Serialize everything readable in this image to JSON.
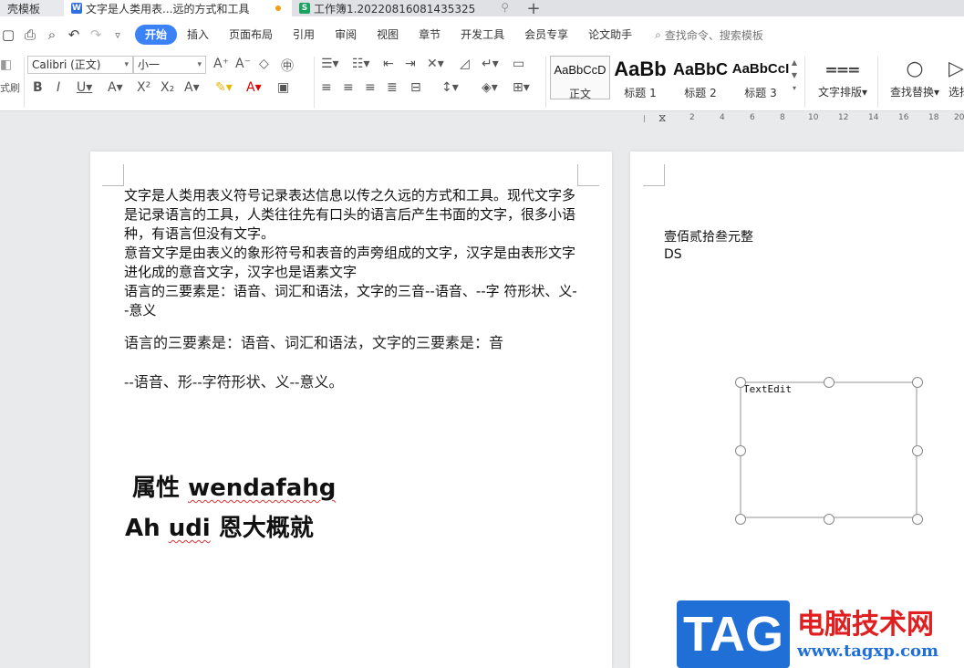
{
  "tabs": [
    {
      "label": "壳模板"
    },
    {
      "label": "文字是人类用表...远的方式和工具"
    },
    {
      "label": "工作簿1.20220816081435325"
    }
  ],
  "menu": {
    "items": [
      "开始",
      "插入",
      "页面布局",
      "引用",
      "审阅",
      "视图",
      "章节",
      "开发工具",
      "会员专享",
      "论文助手"
    ],
    "search": "查找命令、搜索模板"
  },
  "ribbon": {
    "cut_label": "式刷",
    "font_name": "Calibri (正文)",
    "font_size": "小一",
    "styles": [
      {
        "preview": "AaBbCcD",
        "name": "正文"
      },
      {
        "preview": "AaBb",
        "name": "标题 1"
      },
      {
        "preview": "AaBbC",
        "name": "标题 2"
      },
      {
        "preview": "AaBbCcI",
        "name": "标题 3"
      }
    ],
    "text_layout": "文字排版",
    "find_replace": "查找替换",
    "select": "选择"
  },
  "ruler": [
    "2",
    "4",
    "6",
    "8",
    "10",
    "12",
    "14",
    "16",
    "18",
    "20"
  ],
  "page1": {
    "para1": "文字是人类用表义符号记录表达信息以传之久远的方式和工具。现代文字多是记录语言的工具，人类往往先有口头的语言后产生书面的文字，很多小语种，有语言但没有文字。",
    "para2": "意音文字是由表义的象形符号和表音的声旁组成的文字，汉字是由表形文字进化成的意音文字，汉字也是语素文字",
    "para3": "语言的三要素是：语音、词汇和语法，文字的三音--语音、--字 符形状、义--意义",
    "serif_line1": "语言的三要素是：语音、词汇和语法，文字的三要素是：音",
    "serif_line2": "--语音、形--字符形状、义--意义。",
    "big1_a": "属性 ",
    "big1_b": "wendafahg",
    "big2_a": "Ah ",
    "big2_b": "udi",
    "big2_c": " 恩大概就"
  },
  "page2": {
    "line1": "壹佰贰拾叁元整",
    "line2": "DS",
    "textbox_label": "TextEdit"
  },
  "watermark": {
    "tag": "TAG",
    "title": "电脑技术网",
    "url": "www.tagxp.com"
  }
}
